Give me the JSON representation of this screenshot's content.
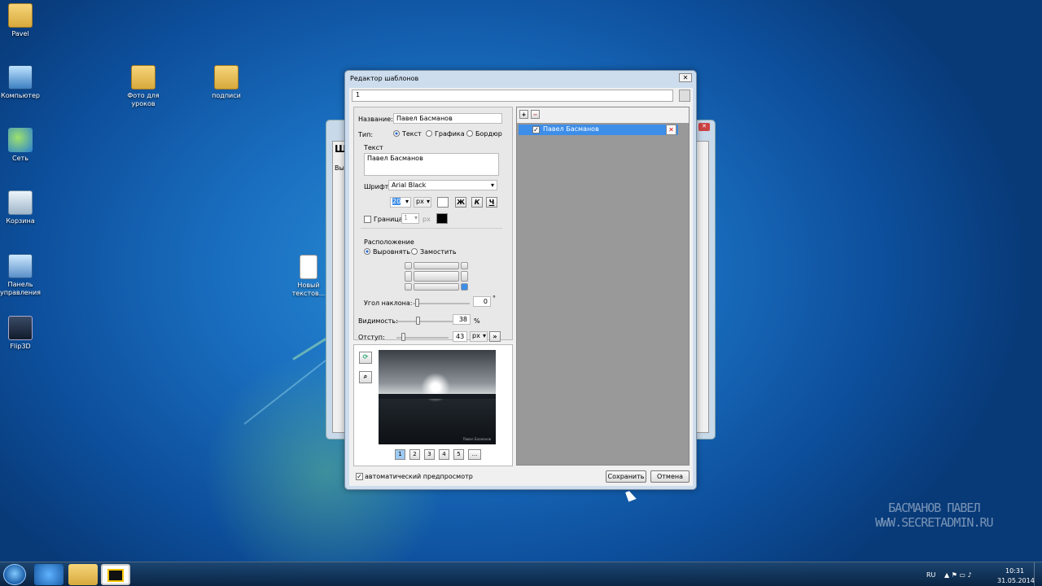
{
  "desktop": {
    "icons": [
      {
        "label": "Pavel",
        "type": "folder"
      },
      {
        "label": "Компьютер",
        "type": "pc"
      },
      {
        "label": "Сеть",
        "type": "globe"
      },
      {
        "label": "Корзина",
        "type": "bin"
      },
      {
        "label": "Панель управления",
        "type": "cpanel"
      },
      {
        "label": "Flip3D",
        "type": "flip"
      },
      {
        "label": "Фото для уроков",
        "type": "folder"
      },
      {
        "label": "подписи",
        "type": "folder"
      },
      {
        "label": "Новый текстов...",
        "type": "doc"
      }
    ],
    "watermark_line1": "БАСМАНОВ ПАВЕЛ",
    "watermark_line2": "WWW.SECRETADMIN.RU"
  },
  "back_window": {
    "title_prefix": "Шаб",
    "label": "Выбе"
  },
  "dialog": {
    "title": "Редактор шаблонов",
    "name_input_value": "1",
    "name_label": "Название:",
    "name_value": "Павел Басманов",
    "type_label": "Тип:",
    "type_options": [
      "Текст",
      "Графика",
      "Бордюр"
    ],
    "type_selected": "Текст",
    "text_section": "Текст",
    "text_value": "Павел Басманов",
    "font_label": "Шрифт:",
    "font_value": "Arial Black",
    "font_size": "20",
    "size_unit": "px",
    "style_buttons": [
      "Ж",
      "К",
      "Ч"
    ],
    "border_label": "Граница",
    "border_size": "1",
    "border_unit": "px",
    "position_section": "Расположение",
    "align_option": "Выровнять",
    "tile_option": "Замостить",
    "angle_label": "Угол наклона:",
    "angle_value": "0",
    "angle_unit": "°",
    "visibility_label": "Видимость:",
    "visibility_value": "38",
    "visibility_unit": "%",
    "offset_label": "Отступ:",
    "offset_value": "43",
    "offset_unit": "px",
    "preview_pages": [
      "1",
      "2",
      "3",
      "4",
      "5",
      "..."
    ],
    "preview_signature": "Павел Басманов",
    "list_item": "Павел Басманов",
    "auto_preview_label": "автоматический предпросмотр",
    "save_button": "Сохранить",
    "cancel_button": "Отмена"
  },
  "taskbar": {
    "lang": "RU",
    "time": "10:31",
    "date": "31.05.2014"
  },
  "colors": {
    "selection": "#3d8ee8",
    "list_bg": "#999999",
    "dialog_frame": "#cdddee"
  }
}
